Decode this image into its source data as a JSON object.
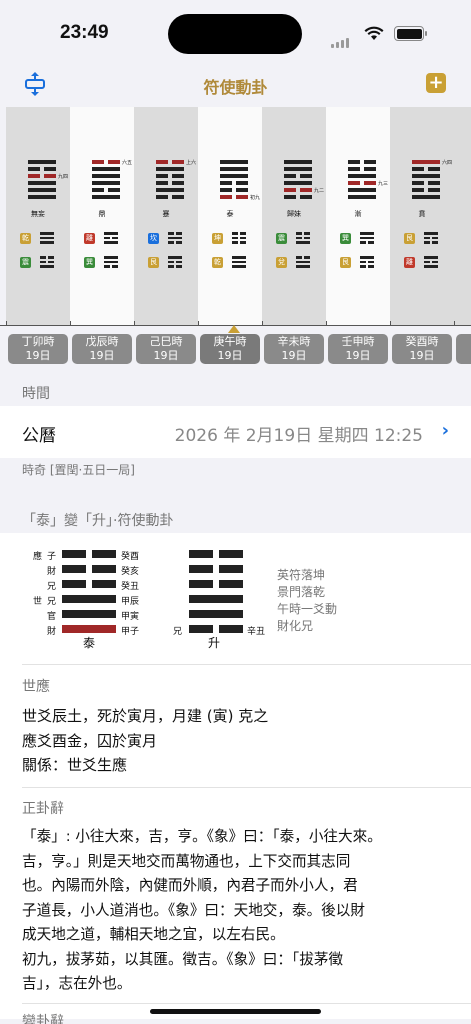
{
  "status": {
    "time": "23:49"
  },
  "nav": {
    "title": "符使動卦",
    "add_label": "+"
  },
  "strip": [
    {
      "name": "無妄",
      "lines": [
        1,
        0,
        0,
        1,
        1,
        1
      ],
      "red": 2,
      "mark": "九四",
      "up": "乾",
      "low": "震"
    },
    {
      "name": "鼎",
      "lines": [
        0,
        1,
        1,
        1,
        0,
        1
      ],
      "red": 0,
      "mark": "六五",
      "up": "離",
      "low": "巽"
    },
    {
      "name": "蹇",
      "lines": [
        0,
        1,
        0,
        0,
        1,
        0
      ],
      "red": 0,
      "mark": "上六",
      "up": "坎",
      "low": "艮"
    },
    {
      "name": "泰",
      "lines": [
        1,
        1,
        1,
        0,
        0,
        0
      ],
      "red": 5,
      "mark": "初九",
      "up": "坤",
      "low": "乾"
    },
    {
      "name": "歸妹",
      "lines": [
        1,
        1,
        0,
        1,
        0,
        0
      ],
      "red": 4,
      "mark": "九二",
      "up": "震",
      "low": "兌"
    },
    {
      "name": "漸",
      "lines": [
        0,
        0,
        1,
        0,
        1,
        1
      ],
      "red": 3,
      "mark": "九三",
      "up": "巽",
      "low": "艮"
    },
    {
      "name": "賁",
      "lines": [
        1,
        0,
        1,
        0,
        0,
        1
      ],
      "red": 0,
      "mark": "六四",
      "up": "艮",
      "low": "離"
    }
  ],
  "periods": [
    {
      "label": "丁卯時",
      "day": "19日"
    },
    {
      "label": "戊辰時",
      "day": "19日"
    },
    {
      "label": "己巳時",
      "day": "19日"
    },
    {
      "label": "庚午時",
      "day": "19日"
    },
    {
      "label": "辛未時",
      "day": "19日"
    },
    {
      "label": "壬申時",
      "day": "19日"
    },
    {
      "label": "癸酉時",
      "day": "19日"
    }
  ],
  "time_section": {
    "header": "時間",
    "calendar_label": "公曆",
    "datetime": "2026 年 2月19日 星期四 12:25",
    "sub": "時奇 [置閏·五日一局]"
  },
  "gua_section": {
    "header": "「泰」變「升」·符使動卦",
    "left_name": "泰",
    "right_name": "升",
    "left_rows": [
      {
        "role": "應",
        "rel": "子",
        "ganzhi": "癸酉"
      },
      {
        "role": "",
        "rel": "財",
        "ganzhi": "癸亥"
      },
      {
        "role": "",
        "rel": "兄",
        "ganzhi": "癸丑"
      },
      {
        "role": "世",
        "rel": "兄",
        "ganzhi": "甲辰"
      },
      {
        "role": "",
        "rel": "官",
        "ganzhi": "甲寅"
      },
      {
        "role": "",
        "rel": "財",
        "ganzhi": "甲子"
      }
    ],
    "right_rel": "兄",
    "right_ganzhi": "辛丑",
    "notes": [
      "英符落坤",
      "景門落乾",
      "午時一爻動",
      "財化兄"
    ]
  },
  "shiying": {
    "header": "世應",
    "lines": [
      "世爻辰土，死於寅月，月建 (寅) 克之",
      "應爻酉金，囚於寅月",
      "關係：世爻生應"
    ]
  },
  "zhenggua": {
    "header": "正卦辭",
    "lines": [
      "「泰」: 小往大來，吉，亨。《象》曰：「泰，小往大來。",
      "吉，亨。」則是天地交而萬物通也，上下交而其志同",
      "也。內陽而外陰，內健而外順，內君子而外小人，君",
      "子道長，小人道消也。《象》曰：天地交，泰。後以財",
      "成天地之道，輔相天地之宜，以左右民。",
      "初九，拔茅茹，以其匯。徵吉。《象》曰：「拔茅徵",
      "吉」，志在外也。"
    ]
  },
  "next_header": "變卦辭",
  "colors": {
    "accent": "#b08a3a",
    "red_line": "#a02828",
    "乾": "#c9a035",
    "震": "#3a8c3a",
    "離": "#c0392b",
    "巽": "#3a8c3a",
    "坎": "#1a6fdc",
    "艮": "#c9a035",
    "坤": "#c9a035",
    "兌": "#c9a035"
  }
}
